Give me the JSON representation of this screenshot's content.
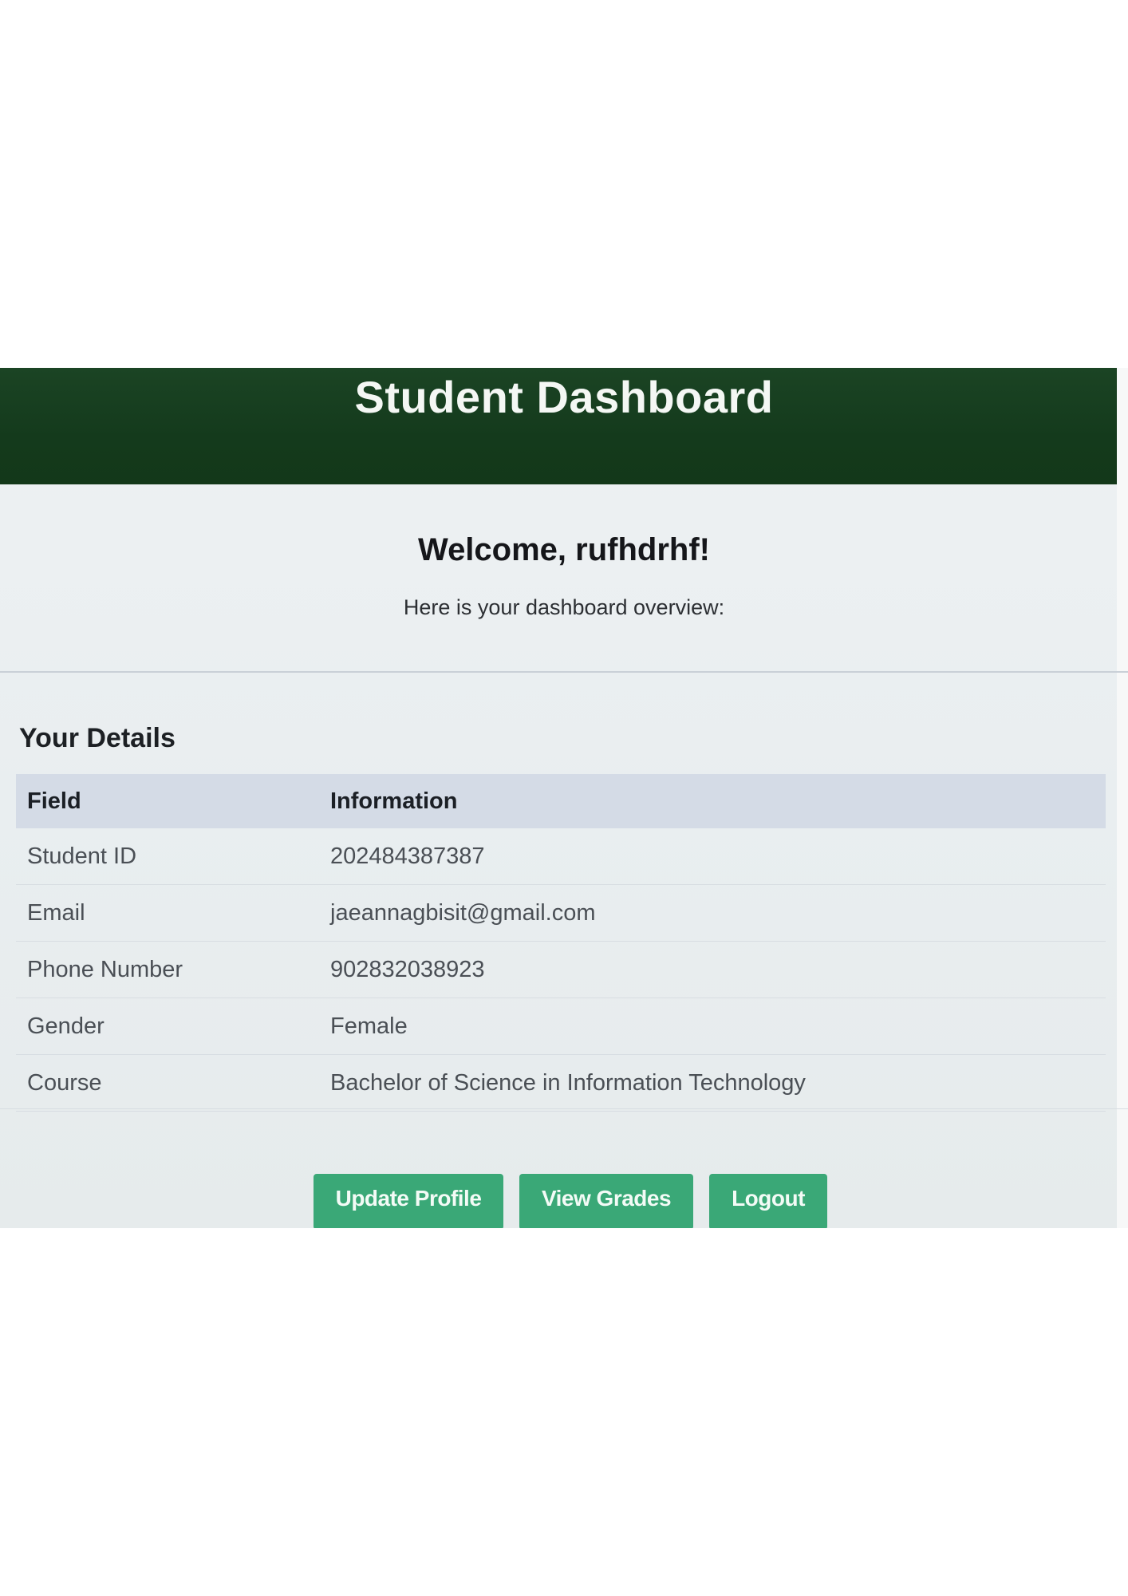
{
  "header": {
    "title": "Student Dashboard"
  },
  "welcome": {
    "heading": "Welcome, rufhdrhf!",
    "subtitle": "Here is your dashboard overview:"
  },
  "details": {
    "title": "Your Details",
    "columns": [
      "Field",
      "Information"
    ],
    "rows": [
      {
        "field": "Student ID",
        "value": "202484387387"
      },
      {
        "field": "Email",
        "value": "jaeannagbisit@gmail.com"
      },
      {
        "field": "Phone Number",
        "value": "902832038923"
      },
      {
        "field": "Gender",
        "value": "Female"
      },
      {
        "field": "Course",
        "value": "Bachelor of Science in Information Technology"
      }
    ]
  },
  "actions": {
    "update_profile": "Update Profile",
    "view_grades": "View Grades",
    "logout": "Logout"
  },
  "colors": {
    "header_bg": "#143a1c",
    "button_bg": "#3aa877",
    "table_head_bg": "#d4dbe6"
  }
}
